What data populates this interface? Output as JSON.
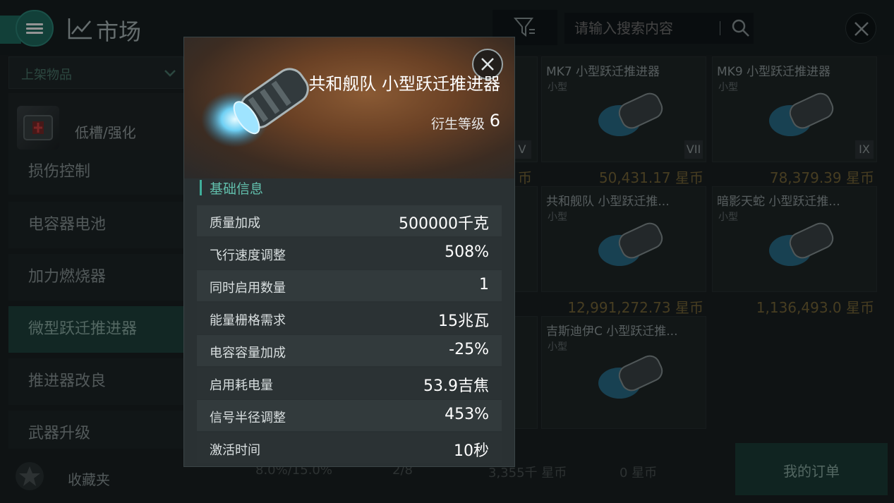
{
  "header": {
    "title": "市场",
    "search_placeholder": "请输入搜索内容"
  },
  "sidebar": {
    "dropdown_label": "上架物品",
    "category_label": "低槽/强化",
    "items": [
      {
        "label": "损伤控制"
      },
      {
        "label": "电容器电池"
      },
      {
        "label": "加力燃烧器"
      },
      {
        "label": "微型跃迁推进器"
      },
      {
        "label": "推进器改良"
      },
      {
        "label": "武器升级"
      }
    ],
    "favorites_label": "收藏夹"
  },
  "grid": {
    "cards": [
      {
        "name": "MK7 小型跃迁推进器",
        "size": "小型",
        "level": "VII",
        "price": "50,431.17 星币"
      },
      {
        "name": "MK9 小型跃迁推进器",
        "size": "小型",
        "level": "IX",
        "price": "78,379.39 星币"
      },
      {
        "name": "共和舰队 小型跃迁推...",
        "size": "小型",
        "price": "12,991,272.73 星币"
      },
      {
        "name": "暗影天蛇 小型跃迁推...",
        "size": "小型",
        "price": "1,136,493.0 星币"
      },
      {
        "name": "吉斯迪伊C 小型跃迁推...",
        "size": "小型"
      }
    ],
    "partial_left": {
      "level": "V",
      "price_suffix": "币"
    }
  },
  "bottom_bar": {
    "tax": "8.0%/15.0%",
    "slots": "2/8",
    "balance": "3,355千 星币",
    "cart": "0 星币",
    "orders_label": "我的订单"
  },
  "popup": {
    "title": "共和舰队 小型跃迁推进器",
    "level_label": "衍生等级",
    "level_value": "6",
    "section_title": "基础信息",
    "stats": [
      {
        "label": "质量加成",
        "value": "500000千克"
      },
      {
        "label": "飞行速度调整",
        "value": "508%"
      },
      {
        "label": "同时启用数量",
        "value": "1"
      },
      {
        "label": "能量栅格需求",
        "value": "15兆瓦"
      },
      {
        "label": "电容容量加成",
        "value": "-25%"
      },
      {
        "label": "启用耗电量",
        "value": "53.9吉焦"
      },
      {
        "label": "信号半径调整",
        "value": "453%"
      },
      {
        "label": "激活时间",
        "value": "10秒"
      }
    ]
  },
  "icons": {
    "menu": "menu-icon",
    "chart": "chart-line-icon",
    "filter": "filter-icon",
    "search": "search-icon",
    "close": "close-icon",
    "star": "star-icon"
  },
  "colors": {
    "accent": "#1f6e63",
    "section_title": "#62c0ad",
    "price": "#c8a04a"
  }
}
